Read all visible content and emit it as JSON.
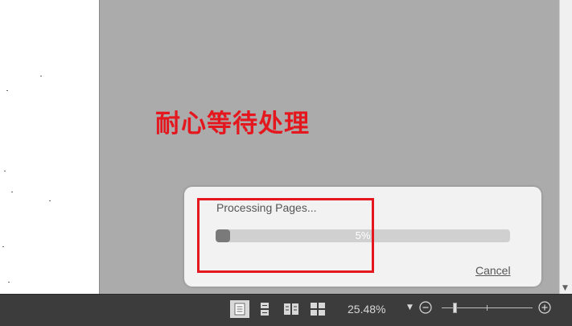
{
  "annotation": {
    "text": "耐心等待处理"
  },
  "dialog": {
    "title": "Processing Pages...",
    "progress_fraction": 0.05,
    "progress_text": "5%",
    "cancel_label": "Cancel"
  },
  "statusbar": {
    "view_modes": [
      "single-page-view-icon",
      "continuous-view-icon",
      "two-page-view-icon",
      "two-page-continuous-view-icon"
    ],
    "active_view": "single-page-view-icon",
    "zoom_level": "25.48%",
    "zoom_slider_fraction": 0.12
  },
  "colors": {
    "annotation_red": "#e4171e",
    "canvas_gray": "#ababab",
    "statusbar_bg": "#3c3c3c",
    "dialog_bg": "#f2f2f2",
    "progress_fill": "#7a7a7a"
  }
}
